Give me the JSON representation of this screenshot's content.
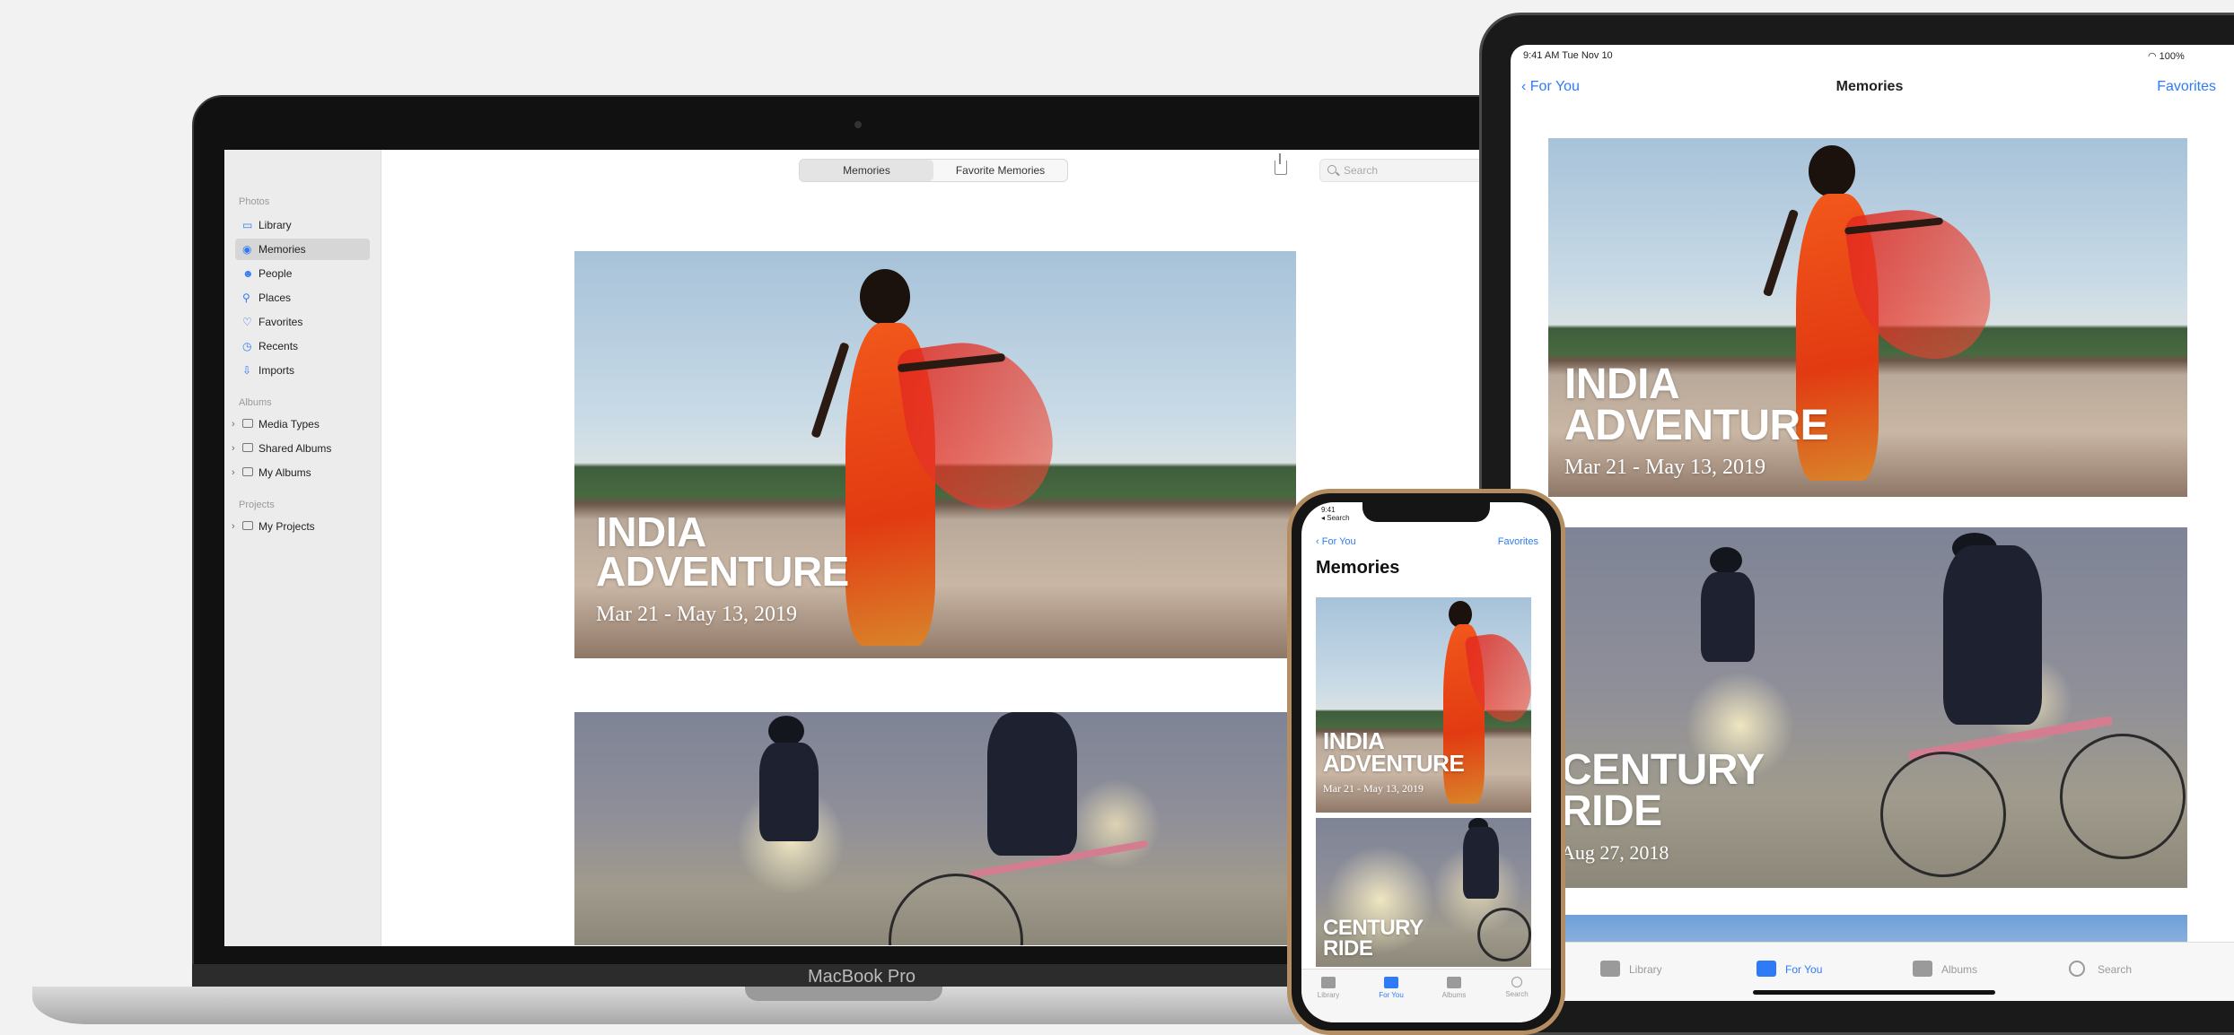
{
  "macbook": {
    "label": "MacBook Pro",
    "sidebar": {
      "sections": [
        {
          "title": "Photos",
          "items": [
            {
              "label": "Library",
              "selected": false,
              "icon": "library-icon"
            },
            {
              "label": "Memories",
              "selected": true,
              "icon": "memories-icon"
            },
            {
              "label": "People",
              "selected": false,
              "icon": "people-icon"
            },
            {
              "label": "Places",
              "selected": false,
              "icon": "places-icon"
            },
            {
              "label": "Favorites",
              "selected": false,
              "icon": "heart-icon"
            },
            {
              "label": "Recents",
              "selected": false,
              "icon": "recents-icon"
            },
            {
              "label": "Imports",
              "selected": false,
              "icon": "imports-icon"
            }
          ]
        },
        {
          "title": "Albums",
          "items": [
            {
              "label": "Media Types",
              "icon": "folder-icon"
            },
            {
              "label": "Shared Albums",
              "icon": "shared-folder-icon"
            },
            {
              "label": "My Albums",
              "icon": "folder-icon"
            }
          ]
        },
        {
          "title": "Projects",
          "items": [
            {
              "label": "My Projects",
              "icon": "folder-icon"
            }
          ]
        }
      ]
    },
    "toolbar": {
      "tabs": [
        "Memories",
        "Favorite Memories"
      ],
      "active_tab": "Memories",
      "search_placeholder": "Search"
    }
  },
  "memories": [
    {
      "title_line1": "INDIA",
      "title_line2": "ADVENTURE",
      "date": "Mar 21 - May 13, 2019"
    },
    {
      "title_line1": "CENTURY",
      "title_line2": "RIDE",
      "date": "Aug 27, 2018"
    }
  ],
  "ipad": {
    "status": {
      "time": "9:41 AM",
      "date": "Tue Nov 10",
      "battery": "100%"
    },
    "nav": {
      "back": "For You",
      "title": "Memories",
      "right": "Favorites"
    },
    "tabs": [
      {
        "label": "Library",
        "icon": "library-icon",
        "active": false
      },
      {
        "label": "For You",
        "icon": "for-you-icon",
        "active": true
      },
      {
        "label": "Albums",
        "icon": "albums-icon",
        "active": false
      },
      {
        "label": "Search",
        "icon": "search-icon",
        "active": false
      }
    ]
  },
  "iphone": {
    "status": {
      "time": "9:41",
      "back_app": "◂ Search"
    },
    "nav": {
      "back": "For You",
      "right": "Favorites"
    },
    "title": "Memories",
    "tabs": [
      {
        "label": "Library",
        "active": false
      },
      {
        "label": "For You",
        "active": true
      },
      {
        "label": "Albums",
        "active": false
      },
      {
        "label": "Search",
        "active": false
      }
    ]
  },
  "colors": {
    "accent": "#2f7bf6",
    "background": "#f2f2f2"
  }
}
